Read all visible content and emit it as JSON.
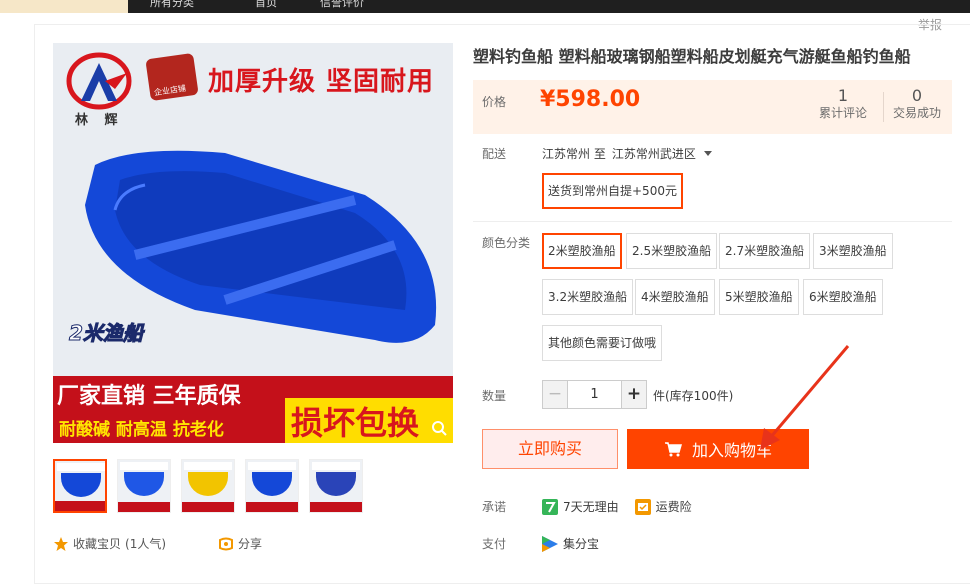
{
  "top_nav": {
    "item1": "所有分类",
    "item2": "首页",
    "item3": "信誉评价"
  },
  "report": "举报",
  "image_text": {
    "brand": "林 辉",
    "badge": "企业店铺",
    "headline": "加厚升级 坚固耐用",
    "size_label": "2米渔船",
    "promo_line1": "厂家直销 三年质保",
    "promo_line2": "耐酸碱 耐高温 抗老化",
    "promo_line3": "损坏包换"
  },
  "product": {
    "title": "塑料钓鱼船 塑料船玻璃钢船塑料船皮划艇充气游艇鱼船钓鱼船"
  },
  "price": {
    "label": "价格",
    "value": "¥598.00",
    "reviews_count": "1",
    "reviews_label": "累计评论",
    "deals_count": "0",
    "deals_label": "交易成功"
  },
  "shipping": {
    "label": "配送",
    "from": "江苏常州 至",
    "to": "江苏常州武进区",
    "option": "送货到常州自提+500元"
  },
  "color": {
    "label": "颜色分类",
    "options": [
      "2米塑胶渔船",
      "2.5米塑胶渔船",
      "2.7米塑胶渔船",
      "3米塑胶渔船",
      "3.2米塑胶渔船",
      "4米塑胶渔船",
      "5米塑胶渔船",
      "6米塑胶渔船",
      "其他颜色需要订做哦"
    ]
  },
  "quantity": {
    "label": "数量",
    "value": "1",
    "stock": "件(库存100件)"
  },
  "actions": {
    "buy_now": "立即购买",
    "add_to_cart": "加入购物车"
  },
  "promise": {
    "label": "承诺",
    "item1": "7天无理由",
    "item2": "运费险"
  },
  "payment": {
    "label": "支付",
    "method": "集分宝"
  },
  "social": {
    "favorite": "收藏宝贝",
    "favorite_count": "(1人气)",
    "share": "分享"
  },
  "colors": {
    "accent": "#ff4400",
    "price_bg": "#fff2e8",
    "boat_blue": "#1448d8"
  }
}
